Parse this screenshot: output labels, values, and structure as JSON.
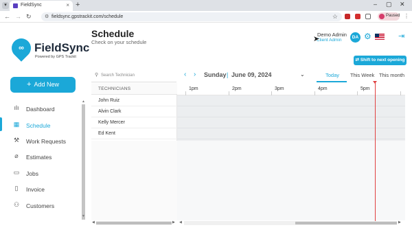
{
  "browser": {
    "tab_title": "FieldSync",
    "tab_close": "×",
    "new_tab": "+",
    "url": "fieldsync.gpstrackit.com/schedule",
    "profile_status": "Paused",
    "min": "–",
    "max": "▢",
    "close": "✕"
  },
  "brand": {
    "name": "FieldSync",
    "tagline": "Powered by GPS Trackit",
    "color": "#1ba8d8"
  },
  "sidebar": {
    "add_button": "Add New",
    "items": [
      {
        "label": "Dashboard",
        "icon": "bar-chart-icon",
        "glyph": "ılı"
      },
      {
        "label": "Schedule",
        "icon": "calendar-icon",
        "glyph": "▦"
      },
      {
        "label": "Work Requests",
        "icon": "wrench-icon",
        "glyph": "⚒"
      },
      {
        "label": "Estimates",
        "icon": "paperclip-icon",
        "glyph": "⌀"
      },
      {
        "label": "Jobs",
        "icon": "briefcase-icon",
        "glyph": "▭"
      },
      {
        "label": "Invoice",
        "icon": "document-icon",
        "glyph": "▯"
      },
      {
        "label": "Customers",
        "icon": "users-icon",
        "glyph": "⚇"
      }
    ]
  },
  "header": {
    "title": "Schedule",
    "subtitle": "Check on your schedule",
    "user_name": "Demo Admin",
    "user_role": "Client Admin",
    "avatar_initials": "DA",
    "shift_button": "Shift to next opening"
  },
  "schedule": {
    "search_placeholder": "Search Technician",
    "day": "Sunday",
    "separator": "|",
    "date": "June 09, 2024",
    "views": [
      "Today",
      "This Week",
      "This month"
    ],
    "active_view": "Today",
    "technicians_header": "TECHNICIANS",
    "technicians": [
      "John Ruiz",
      "Alvin Clark",
      "Kelly Mercer",
      "Ed Kent"
    ],
    "hours": [
      "1pm",
      "2pm",
      "3pm",
      "4pm",
      "5pm"
    ]
  }
}
